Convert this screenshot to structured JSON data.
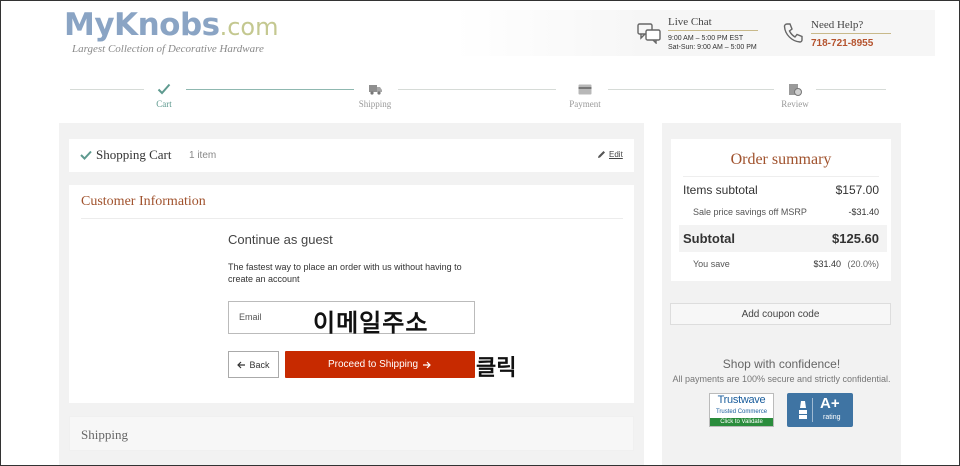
{
  "header": {
    "logo_main": "MyKnobs",
    "logo_suffix": ".com",
    "logo_tagline": "Largest Collection of Decorative Hardware",
    "live_chat": {
      "title": "Live Chat",
      "hours_weekday": "9:00 AM – 5:00 PM EST",
      "hours_weekend": "Sat-Sun: 9:00 AM – 5:00 PM"
    },
    "need_help": {
      "title": "Need Help?",
      "phone": "718-721-8955"
    }
  },
  "steps": [
    {
      "label": "Cart",
      "icon": "check-icon",
      "active": true
    },
    {
      "label": "Shipping",
      "icon": "truck-icon",
      "active": false
    },
    {
      "label": "Payment",
      "icon": "credit-card-icon",
      "active": false
    },
    {
      "label": "Review",
      "icon": "review-icon",
      "active": false
    }
  ],
  "cart": {
    "title": "Shopping Cart",
    "count": "1 item",
    "edit_label": "Edit"
  },
  "customer": {
    "title": "Customer Information",
    "guest_title": "Continue as guest",
    "guest_desc": "The fastest way to place an order with us without having to create an account",
    "email_label": "Email",
    "email_annotation": "이메일주소",
    "back_label": "Back",
    "proceed_label": "Proceed to Shipping",
    "click_annotation": "클릭"
  },
  "shipping_section": {
    "title": "Shipping"
  },
  "summary": {
    "title": "Order summary",
    "items_subtotal_label": "Items subtotal",
    "items_subtotal_value": "$157.00",
    "savings_label": "Sale price savings off MSRP",
    "savings_value": "-$31.40",
    "subtotal_label": "Subtotal",
    "subtotal_value": "$125.60",
    "you_save_label": "You save",
    "you_save_value": "$31.40",
    "you_save_percent": "(20.0%)"
  },
  "coupon": {
    "label": "Add coupon code"
  },
  "confidence": {
    "title": "Shop with confidence!",
    "subtitle": "All payments are 100% secure and strictly confidential."
  },
  "badges": {
    "trustwave_name": "Trustwave",
    "trustwave_line": "Trusted Commerce",
    "trustwave_cta": "Click to Validate",
    "bbb_grade": "A+",
    "bbb_rating": "rating"
  },
  "colors": {
    "accent": "#c72a00",
    "heading": "#a0522d",
    "active_step": "#5e9a8f"
  }
}
